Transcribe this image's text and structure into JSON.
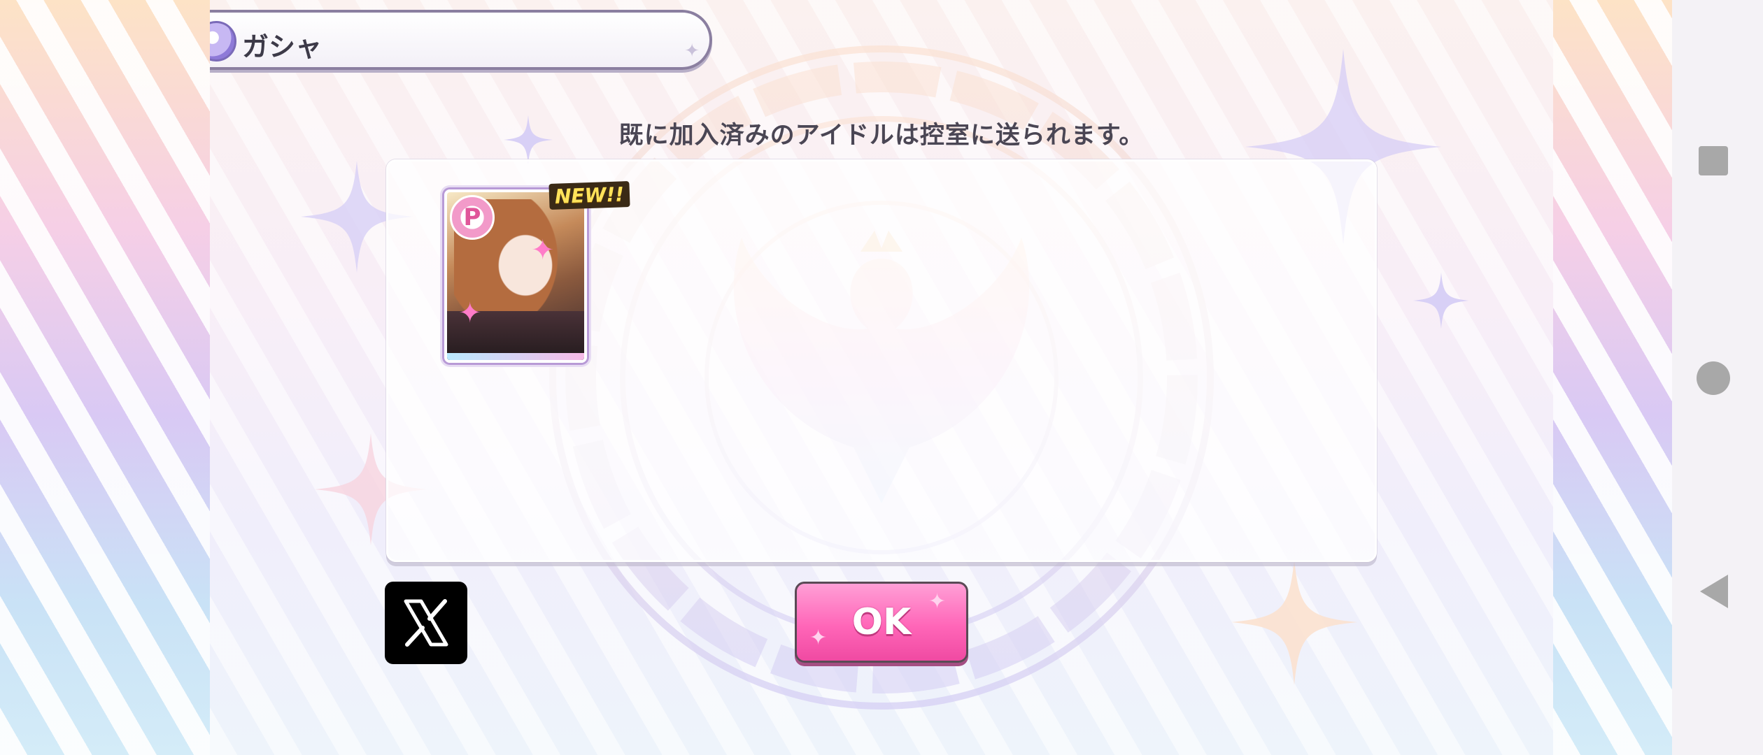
{
  "header": {
    "title": "ガシャ",
    "icon": "gacha-swan-icon"
  },
  "notice": "既に加入済みのアイドルは控室に送られます。",
  "results": [
    {
      "attribute_badge": "P",
      "new_label": "NEW!!"
    }
  ],
  "buttons": {
    "share_x_icon": "x-logo-icon",
    "ok_label": "OK"
  },
  "colors": {
    "ok_pink": "#ff66b8",
    "header_border": "#8b7fa0",
    "accent_lavender": "#c7b8f3"
  },
  "system_nav": {
    "recents": "square-icon",
    "home": "circle-icon",
    "back": "triangle-back-icon"
  }
}
